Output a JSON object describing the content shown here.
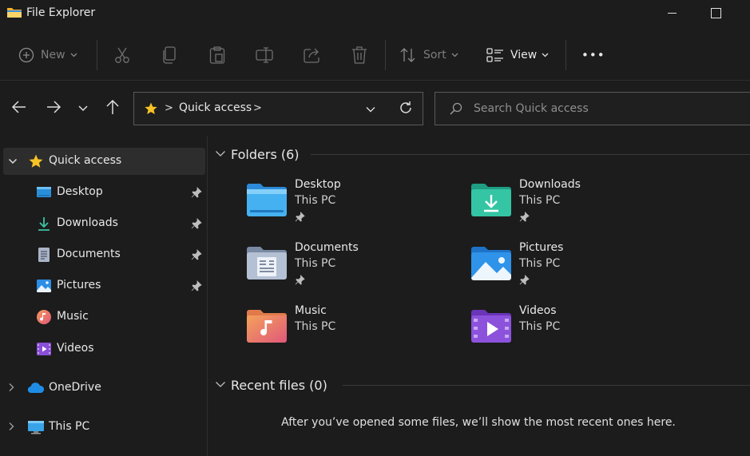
{
  "window": {
    "title": "File Explorer",
    "icon": "folder-icon"
  },
  "toolbar": {
    "new_label": "New",
    "sort_label": "Sort",
    "view_label": "View",
    "more_label": "•••",
    "disabled_actions": [
      "cut-icon",
      "copy-icon",
      "paste-icon",
      "rename-icon",
      "share-icon",
      "delete-icon"
    ]
  },
  "address": {
    "breadcrumb": "Quick access",
    "separator": ">"
  },
  "search": {
    "placeholder": "Search Quick access"
  },
  "sidebar": {
    "items": [
      {
        "label": "Quick access",
        "icon": "star-icon",
        "selected": true,
        "expanded": true
      },
      {
        "label": "Desktop",
        "icon": "desktop-icon",
        "pinned": true
      },
      {
        "label": "Downloads",
        "icon": "download-icon",
        "pinned": true
      },
      {
        "label": "Documents",
        "icon": "documents-icon",
        "pinned": true
      },
      {
        "label": "Pictures",
        "icon": "pictures-icon",
        "pinned": true
      },
      {
        "label": "Music",
        "icon": "music-icon"
      },
      {
        "label": "Videos",
        "icon": "videos-icon"
      },
      {
        "label": "OneDrive",
        "icon": "onedrive-icon",
        "expanded": false
      },
      {
        "label": "This PC",
        "icon": "this-pc-icon",
        "expanded": false
      }
    ]
  },
  "main": {
    "folders_header": "Folders (6)",
    "folders": [
      {
        "name": "Desktop",
        "location": "This PC",
        "pinned": true,
        "icon": "desktop-folder-icon"
      },
      {
        "name": "Downloads",
        "location": "This PC",
        "pinned": true,
        "icon": "downloads-folder-icon"
      },
      {
        "name": "Documents",
        "location": "This PC",
        "pinned": true,
        "icon": "documents-folder-icon"
      },
      {
        "name": "Pictures",
        "location": "This PC",
        "pinned": true,
        "icon": "pictures-folder-icon"
      },
      {
        "name": "Music",
        "location": "This PC",
        "pinned": false,
        "icon": "music-folder-icon"
      },
      {
        "name": "Videos",
        "location": "This PC",
        "pinned": false,
        "icon": "videos-folder-icon"
      }
    ],
    "recent_header": "Recent files (0)",
    "recent_empty_message": "After you’ve opened some files, we’ll show the most recent ones here."
  },
  "colors": {
    "background": "#1c1c1c",
    "selected": "#2d2d2d",
    "border": "#5a5a5a",
    "star": "#f7c325",
    "disabled": "#7d7d7d"
  }
}
